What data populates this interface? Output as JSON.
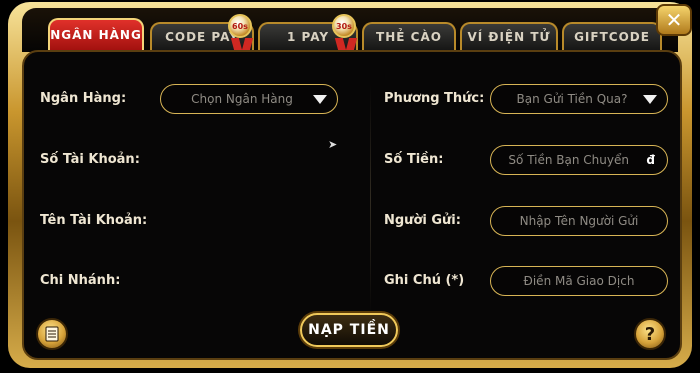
{
  "tabs": [
    {
      "label": "NGÂN HÀNG",
      "active": true
    },
    {
      "label": "CODE PAY",
      "active": false,
      "badge": "60s"
    },
    {
      "label": "1 PAY",
      "active": false,
      "badge": "30s"
    },
    {
      "label": "THẺ CÀO",
      "active": false
    },
    {
      "label": "VÍ ĐIỆN TỬ",
      "active": false
    },
    {
      "label": "GIFTCODE",
      "active": false
    }
  ],
  "close_label": "✕",
  "left_form": {
    "bank_label": "Ngân Hàng:",
    "bank_select": "Chọn Ngân Hàng",
    "account_number_label": "Số Tài Khoản:",
    "account_name_label": "Tên Tài Khoản:",
    "branch_label": "Chi Nhánh:"
  },
  "right_form": {
    "method_label": "Phương Thức:",
    "method_select": "Bạn Gửi Tiền Qua?",
    "amount_label": "Số Tiền:",
    "amount_placeholder": "Số Tiền Bạn Chuyển",
    "amount_currency": "đ",
    "sender_label": "Người Gửi:",
    "sender_placeholder": "Nhập Tên Người Gửi",
    "note_label": "Ghi Chú (*)",
    "note_placeholder": "Điền Mã Giao Dịch"
  },
  "submit_label": "NẠP TIỀN",
  "help_label": "?",
  "colors": {
    "accent_gold": "#d7b455",
    "active_tab": "#c81f1a"
  }
}
